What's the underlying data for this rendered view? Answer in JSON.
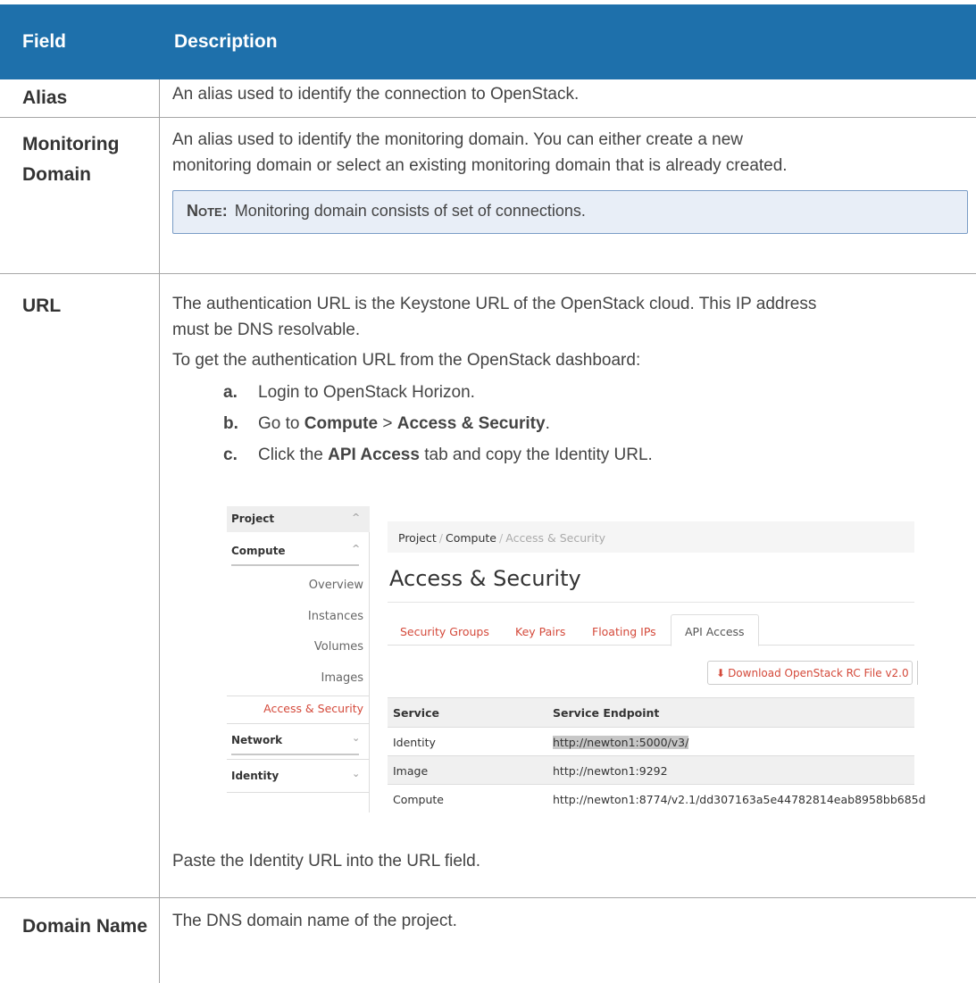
{
  "header": {
    "field": "Field",
    "description": "Description"
  },
  "rows": {
    "alias": {
      "field": "Alias",
      "description": "An alias used to identify the connection to OpenStack."
    },
    "monitoring_domain": {
      "field": "Monitoring Domain",
      "description_line1": "An alias used to identify the monitoring domain. You can either create a new",
      "description_line2": "monitoring domain or select an existing monitoring domain that is already created.",
      "note_label": "Note:",
      "note_text": "Monitoring domain consists of set of connections."
    },
    "url": {
      "field": "URL",
      "description_line1": "The authentication URL is the Keystone URL of the OpenStack cloud. This IP address",
      "description_line2": "must be DNS resolvable.",
      "intro": "To get the authentication URL from the OpenStack dashboard:",
      "steps": [
        {
          "letter": "a.",
          "text": "Login to OpenStack Horizon."
        },
        {
          "letter": "b.",
          "pre": "Go to ",
          "bold1": "Compute",
          "mid": " > ",
          "bold2": "Access & Security",
          "post": "."
        },
        {
          "letter": "c.",
          "pre": "Click the ",
          "bold1": "API Access",
          "post": " tab and copy the Identity URL."
        }
      ],
      "closing": "Paste the Identity URL into the URL field."
    },
    "domain_name": {
      "field": "Domain Name",
      "description": "The DNS domain name of the project."
    }
  },
  "screenshot": {
    "sidebar": {
      "project": "Project",
      "compute": "Compute",
      "items": [
        "Overview",
        "Instances",
        "Volumes",
        "Images"
      ],
      "active_item": "Access & Security",
      "network": "Network",
      "identity": "Identity",
      "chevron_up": "^",
      "chevron_down": "⌄"
    },
    "breadcrumb": {
      "project": "Project",
      "compute": "Compute",
      "current": "Access & Security",
      "separator": "/"
    },
    "title": "Access & Security",
    "tabs": [
      "Security Groups",
      "Key Pairs",
      "Floating IPs",
      "API Access"
    ],
    "download_button": "Download OpenStack RC File v2.0",
    "download_icon": "⬇",
    "table": {
      "headers": [
        "Service",
        "Service Endpoint"
      ],
      "rows": [
        [
          "Identity",
          "http://newton1:5000/v3/"
        ],
        [
          "Image",
          "http://newton1:9292"
        ],
        [
          "Compute",
          "http://newton1:8774/v2.1/dd307163a5e44782814eab8958bb685d"
        ]
      ]
    }
  },
  "colors": {
    "header_bg": "#1e70ab",
    "note_bg": "#e8eef7",
    "note_border": "#7a9cc6",
    "link_red": "#d4493a"
  }
}
